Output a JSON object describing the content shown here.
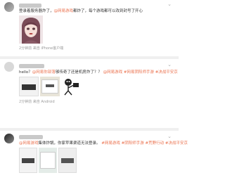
{
  "posts": [
    {
      "text_pre": "登录着服务器炸了，",
      "mention": "@网易游戏",
      "text_post": "都炸了，每个游戏都可以改到封号了开心",
      "meta_pre": "2分钟前 来自 iPhone客户端"
    },
    {
      "text_pre": "hello？",
      "mention": "@网易你部落",
      "text_post": "够传奇了还是机房炸了？？",
      "topics": [
        "@网易游戏",
        "#网易阴阳师手游",
        "#决战平安京"
      ],
      "meta_pre": "2分钟前 来自 Android"
    },
    {
      "mention": "@网易游戏",
      "text_post": "集体炸锅，你家苹果渠道无法登录。",
      "topics": [
        "#网易游戏",
        "#阴阳师手游",
        "#荒野行动",
        "#决战平安京"
      ]
    }
  ],
  "icons": {
    "more": "chevron-down-icon"
  },
  "colors": {
    "mention": "#eb7350",
    "meta": "#9a9a9a"
  }
}
